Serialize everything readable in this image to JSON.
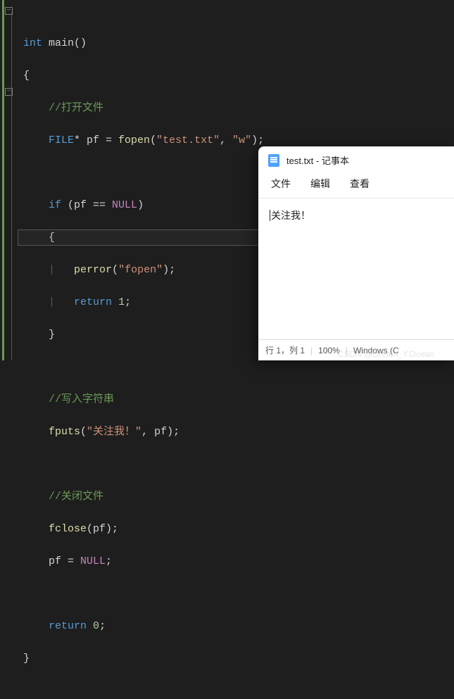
{
  "code": {
    "l1": "int",
    "l1b": " main()",
    "l2": "{",
    "l3_cmt": "//打开文件",
    "l4_type": "FILE",
    "l4_b": "* pf = ",
    "l4_fn": "fopen",
    "l4_c": "(",
    "l4_s1": "\"test.txt\"",
    "l4_d": ", ",
    "l4_s2": "\"w\"",
    "l4_e": ");",
    "l6_kw": "if",
    "l6_b": " (pf == ",
    "l6_null": "NULL",
    "l6_c": ")",
    "l7": "{",
    "l8_fn": "perror",
    "l8_b": "(",
    "l8_s": "\"fopen\"",
    "l8_c": ");",
    "l9_kw": "return",
    "l9_b": " ",
    "l9_n": "1",
    "l9_c": ";",
    "l10": "}",
    "l12_cmt": "//写入字符串",
    "l13_fn": "fputs",
    "l13_b": "(",
    "l13_s": "\"关注我！\"",
    "l13_c": ", pf);",
    "l15_cmt": "//关闭文件",
    "l16_fn": "fclose",
    "l16_b": "(pf);",
    "l17_a": "pf = ",
    "l17_null": "NULL",
    "l17_b": ";",
    "l19_kw": "return",
    "l19_b": " ",
    "l19_n": "0",
    "l19_c": ";",
    "l20": "}"
  },
  "notepad": {
    "title": "test.txt - 记事本",
    "menu": {
      "file": "文件",
      "edit": "编辑",
      "view": "查看"
    },
    "content": "关注我！",
    "status": {
      "pos": "行 1，列 1",
      "zoom": "100%",
      "os": "Windows (C"
    }
  },
  "watermark": "CSDN @Dream_Y.Ocean"
}
